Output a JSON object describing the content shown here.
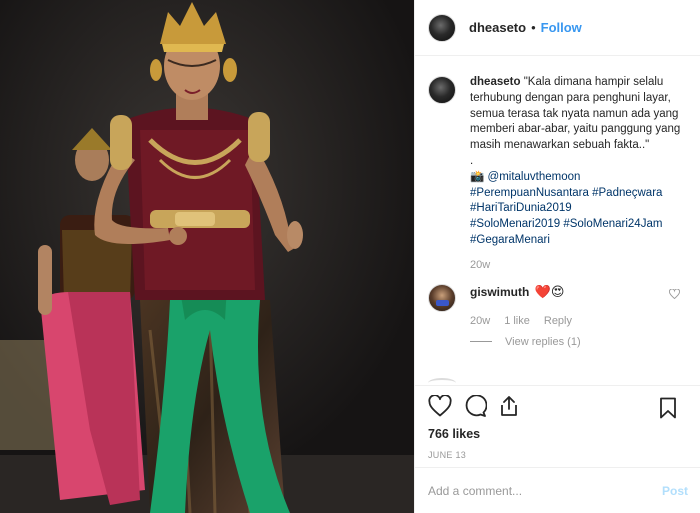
{
  "post": {
    "username": "dheaseto",
    "follow_separator": "•",
    "follow_label": "Follow"
  },
  "caption": {
    "username": "dheaseto",
    "text": "\"Kala dimana hampir selalu terhubung dengan para penghuni layar, semua terasa tak nyata namun ada yang memberi abar-abar, yaitu panggung yang masih menawarkan sebuah fakta..\"",
    "separator": ".",
    "camera_emoji": "📸",
    "mention": "@mitaluvthemoon",
    "hashtags": [
      "#PerempuanNusantara #Padneçwara",
      "#HariTariDunia2019",
      "#SoloMenari2019 #SoloMenari24Jam",
      "#GegaraMenari"
    ],
    "age": "20w"
  },
  "reply": {
    "username": "giswimuth",
    "emojis": "❤️😍",
    "age": "20w",
    "likes": "1 like",
    "reply_label": "Reply",
    "view_replies": "View replies (1)"
  },
  "actions": {
    "likes": "766 likes",
    "date": "JUNE 13"
  },
  "add_comment": {
    "placeholder": "Add a comment...",
    "post_label": "Post"
  },
  "colors": {
    "follow": "#3897f0",
    "hashtag": "#003569",
    "muted": "#999999",
    "post_disabled": "#b2dffc"
  },
  "icons": [
    "heart-icon",
    "comment-icon",
    "share-icon",
    "bookmark-icon",
    "small-heart-icon"
  ]
}
